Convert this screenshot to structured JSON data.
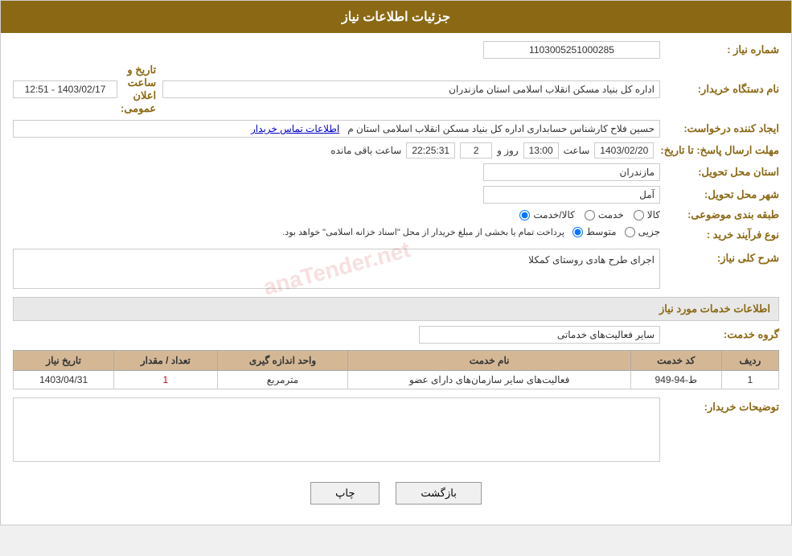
{
  "header": {
    "title": "جزئیات اطلاعات نیاز"
  },
  "fields": {
    "need_number_label": "شماره نیاز :",
    "need_number_value": "1103005251000285",
    "buyer_org_label": "نام دستگاه خریدار:",
    "buyer_org_value": "اداره کل بنیاد مسکن انقلاب اسلامی استان مازندران",
    "publish_date_label": "تاریخ و ساعت اعلان عمومی:",
    "publish_date_value": "1403/02/17 - 12:51",
    "requester_label": "ایجاد کننده درخواست:",
    "requester_value": "حسین فلاح کارشناس حسابداری اداره کل بنیاد مسکن انقلاب اسلامی استان م",
    "requester_contact_link": "اطلاعات تماس خریدار",
    "deadline_label": "مهلت ارسال پاسخ: تا تاریخ:",
    "deadline_date": "1403/02/20",
    "deadline_time_label": "ساعت",
    "deadline_time": "13:00",
    "deadline_days_label": "روز و",
    "deadline_days": "2",
    "deadline_remaining_label": "ساعت باقی مانده",
    "deadline_remaining": "22:25:31",
    "province_label": "استان محل تحویل:",
    "province_value": "مازندران",
    "city_label": "شهر محل تحویل:",
    "city_value": "آمل",
    "category_label": "طبقه بندی موضوعی:",
    "category_radio_1": "کالا",
    "category_radio_2": "خدمت",
    "category_radio_3": "کالا/خدمت",
    "process_label": "نوع فرآیند خرید :",
    "process_radio_1": "جزیی",
    "process_radio_2": "متوسط",
    "process_note": "پرداخت تمام یا بخشی از مبلغ خریدار از محل \"اسناد خزانه اسلامی\" خواهد بود.",
    "description_label": "شرح کلی نیاز:",
    "description_value": "اجرای طرح هادی روستای کمکلا",
    "services_section_label": "اطلاعات خدمات مورد نیاز",
    "service_group_label": "گروه خدمت:",
    "service_group_value": "سایر فعالیت‌های خدماتی",
    "table": {
      "columns": [
        "ردیف",
        "کد خدمت",
        "نام خدمت",
        "واحد اندازه گیری",
        "تعداد / مقدار",
        "تاریخ نیاز"
      ],
      "rows": [
        {
          "row": "1",
          "code": "ط-94-949",
          "name": "فعالیت‌های سایر سازمان‌های دارای عضو",
          "unit": "مترمربع",
          "quantity": "1",
          "date": "1403/04/31"
        }
      ]
    },
    "buyer_notes_label": "توضیحات خریدار:",
    "buyer_notes_value": ""
  },
  "buttons": {
    "print_label": "چاپ",
    "back_label": "بازگشت"
  }
}
